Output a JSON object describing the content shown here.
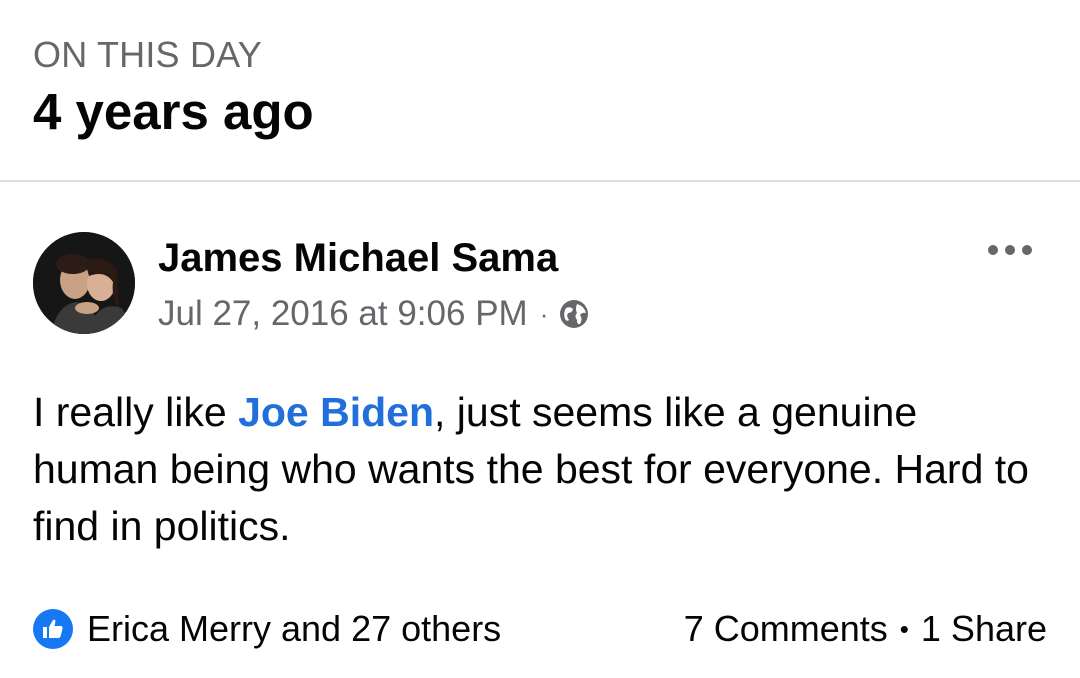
{
  "memory": {
    "kicker": "ON THIS DAY",
    "title": "4 years ago"
  },
  "post": {
    "author": "James Michael Sama",
    "timestamp": "Jul 27, 2016 at 9:06 PM",
    "separator": "·",
    "audience_icon": "globe-icon",
    "text_before": "I really like ",
    "mention": "Joe Biden",
    "text_after": ", just seems like a genuine human being who wants the best for everyone. Hard to find in politics."
  },
  "footer": {
    "reaction_icon": "like-icon",
    "reactions_text": "Erica Merry and 27 others",
    "comments": "7 Comments",
    "separator": "•",
    "shares": "1 Share"
  },
  "colors": {
    "link": "#216fdb",
    "like": "#1877f2",
    "secondary_text": "#65676b"
  }
}
